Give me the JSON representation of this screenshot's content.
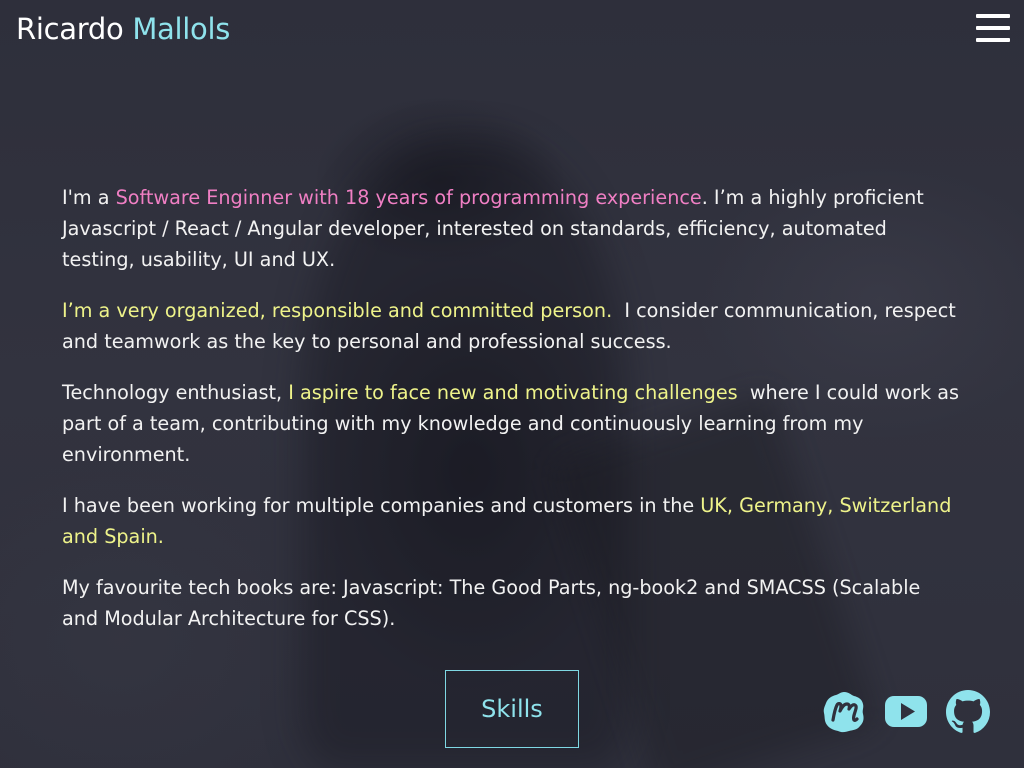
{
  "header": {
    "first_name": "Ricardo",
    "last_name": "Mallols",
    "menu_icon": "hamburger-menu-icon"
  },
  "about": {
    "p1": {
      "before": "I'm a ",
      "highlight": "Software Enginner with 18 years of programming experience",
      "after": ". I’m a highly proficient Javascript / React / Angular developer, interested on standards, efficiency, automated testing, usability, UI and UX."
    },
    "p2": {
      "highlight": "I’m a very organized, responsible and committed person.",
      "after": "  I consider communication, respect and teamwork as the key to personal and professional success."
    },
    "p3": {
      "before": "Technology enthusiast, ",
      "highlight": "I aspire to face new and motivating challenges",
      "after": "  where I could work as part of a team, contributing with my knowledge and continuously learning from my environment."
    },
    "p4": {
      "before": "I have been working for multiple companies and customers in the ",
      "highlight": "UK, Germany, Switzerland and Spain."
    },
    "p5": {
      "text": "My favourite tech books are: Javascript: The Good Parts, ng-book2 and SMACSS (Scalable and Modular Architecture for CSS)."
    }
  },
  "skills_button": {
    "label": "Skills"
  },
  "social": [
    {
      "icon": "meetup-icon",
      "color": "#8fe3ec"
    },
    {
      "icon": "youtube-icon",
      "color": "#8fe3ec"
    },
    {
      "icon": "github-icon",
      "color": "#8fe3ec"
    }
  ],
  "colors": {
    "accent_cyan": "#8fe3ec",
    "highlight_pink": "#f07fc4",
    "highlight_yellow": "#eef38a",
    "background": "#30313d"
  }
}
